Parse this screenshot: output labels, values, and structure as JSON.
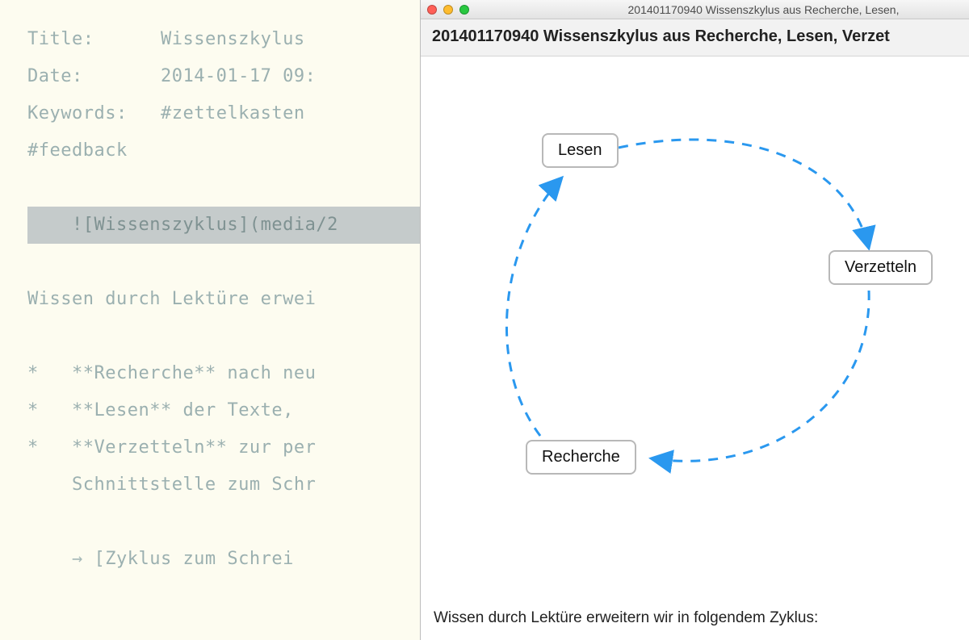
{
  "editor": {
    "title_label": "Title:",
    "title_value": "Wissenszkylus ",
    "date_label": "Date:",
    "date_value": "2014-01-17 09:",
    "keywords_label": "Keywords:",
    "keywords_value": "#zettelkasten ",
    "tag_feedback": "#feedback",
    "image_md": "![Wissenszyklus](media/2",
    "intro": "Wissen durch Lektüre erwei",
    "bullets": [
      {
        "star": "*",
        "bold": "**Recherche**",
        "rest": " nach neu"
      },
      {
        "star": "*",
        "bold": "**Lesen**",
        "rest": " der Texte,"
      },
      {
        "star": "*",
        "bold": "**Verzetteln**",
        "rest": " zur per"
      }
    ],
    "cont_line": "Schnittstelle zum Schr",
    "link_arrow": "→",
    "link_text": " [Zyklus zum Schrei"
  },
  "preview": {
    "window_title": "201401170940 Wissenszkylus aus Recherche, Lesen,",
    "doc_title": "201401170940 Wissenszkylus aus Recherche, Lesen, Verzet",
    "nodes": {
      "lesen": "Lesen",
      "verzetteln": "Verzetteln",
      "recherche": "Recherche"
    },
    "body": "Wissen durch Lektüre erweitern wir in folgendem Zyklus:"
  },
  "colors": {
    "arrow": "#2a98ef"
  }
}
